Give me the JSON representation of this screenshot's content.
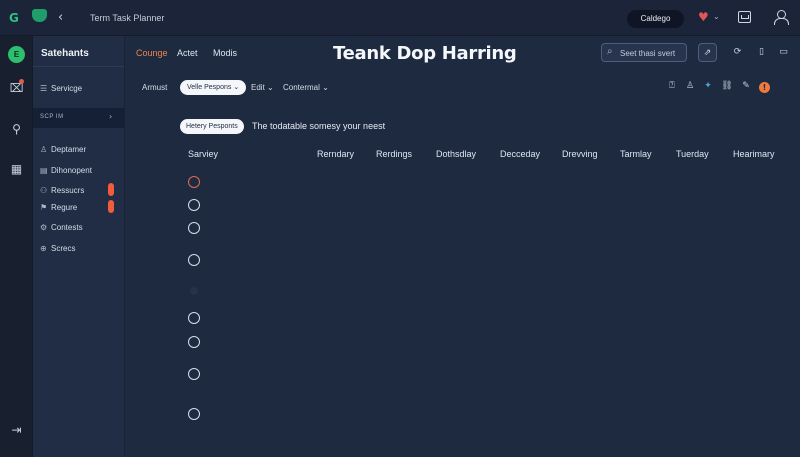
{
  "app": {
    "logo_glyph": "G",
    "window_title": "Term Task Planner",
    "back_glyph": "‹"
  },
  "account": {
    "name": "Caldego"
  },
  "rail": {
    "avatar_text": "E",
    "icons": [
      "chart-icon",
      "pin-icon",
      "grid-icon",
      "exit-icon"
    ]
  },
  "sidebar": {
    "title": "Satehants",
    "item_top": {
      "label": "Servicge",
      "icon": "list-icon"
    },
    "section": {
      "label": "SCP IM",
      "chevron": "›"
    },
    "items": [
      {
        "label": "Deptamer",
        "icon": "user-icon"
      },
      {
        "label": "Dihonopent",
        "icon": "file-icon"
      },
      {
        "label": "Ressucrs",
        "icon": "people-icon",
        "flag_color": "#f05c3c"
      },
      {
        "label": "Regure",
        "icon": "tag-icon",
        "flag_color": "#f05c3c"
      },
      {
        "label": "Contests",
        "icon": "settings-icon"
      },
      {
        "label": "Screcs",
        "icon": "circle-plus-icon"
      }
    ]
  },
  "header": {
    "tabs": [
      {
        "label": "Counge",
        "active": true
      },
      {
        "label": "Actet",
        "active": false
      },
      {
        "label": "Modis",
        "active": false
      }
    ],
    "title": "Teank Dop Harring",
    "search": {
      "placeholder": "Seet thasi svert"
    }
  },
  "toolbar": {
    "filter_label": "Armust",
    "view_select": "Velle Pespons",
    "edit_label": "Edit",
    "context_label": "Contermal",
    "icons": [
      "help-icon",
      "user-icon",
      "twitter-icon",
      "link-icon",
      "pencil-icon",
      "alert-icon"
    ]
  },
  "subheader": {
    "pill": "Hetery Pesponts",
    "text": "The todatable somesy your neest"
  },
  "table": {
    "columns": [
      "Sarviey",
      "Rerndary",
      "Rerdings",
      "Dothsdlay",
      "Decceday",
      "Drevving",
      "Tarmlay",
      "Tuerday",
      "Hearimary"
    ],
    "rows": [
      {
        "state": "active"
      },
      {
        "state": "default"
      },
      {
        "state": "default"
      },
      {
        "state": "default"
      },
      {
        "state": "faint"
      },
      {
        "state": "default"
      },
      {
        "state": "default"
      },
      {
        "state": "default"
      },
      {
        "state": "default"
      }
    ]
  },
  "colors": {
    "accent": "#f0854a",
    "background": "#1e2a40",
    "flag": "#f05c3c",
    "brand_green": "#2ec27e"
  }
}
